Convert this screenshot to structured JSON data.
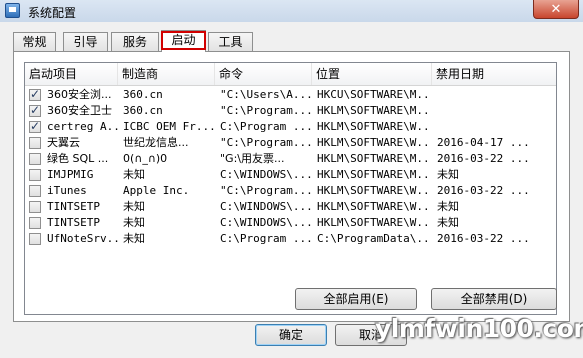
{
  "window": {
    "title": "系统配置",
    "close_glyph": "✕"
  },
  "tabs": [
    {
      "label": "常规",
      "active": false
    },
    {
      "label": "引导",
      "active": false
    },
    {
      "label": "服务",
      "active": false
    },
    {
      "label": "启动",
      "active": true
    },
    {
      "label": "工具",
      "active": false
    }
  ],
  "table": {
    "columns": [
      "启动项目",
      "制造商",
      "命令",
      "位置",
      "禁用日期"
    ],
    "rows": [
      {
        "checked": true,
        "item": "360安全浏...",
        "maker": "360.cn",
        "command": "\"C:\\Users\\A...",
        "location": "HKCU\\SOFTWARE\\M...",
        "date": ""
      },
      {
        "checked": true,
        "item": "360安全卫士",
        "maker": "360.cn",
        "command": "\"C:\\Program...",
        "location": "HKLM\\SOFTWARE\\M...",
        "date": ""
      },
      {
        "checked": true,
        "item": "certreg A...",
        "maker": "ICBC OEM Fr...",
        "command": "C:\\Program ...",
        "location": "HKLM\\SOFTWARE\\W...",
        "date": ""
      },
      {
        "checked": false,
        "item": "天翼云",
        "maker": "世纪龙信息...",
        "command": "\"C:\\Program...",
        "location": "HKLM\\SOFTWARE\\W...",
        "date": "2016-04-17 ..."
      },
      {
        "checked": false,
        "item": "绿色 SQL ...",
        "maker": "0(∩_∩)0",
        "command": "\"G:\\用友票...",
        "location": "HKLM\\SOFTWARE\\M...",
        "date": "2016-03-22 ..."
      },
      {
        "checked": false,
        "item": "IMJPMIG",
        "maker": "未知",
        "command": "C:\\WINDOWS\\...",
        "location": "HKLM\\SOFTWARE\\M...",
        "date": "未知"
      },
      {
        "checked": false,
        "item": "iTunes",
        "maker": "Apple Inc.",
        "command": "\"C:\\Program...",
        "location": "HKLM\\SOFTWARE\\W...",
        "date": "2016-03-22 ..."
      },
      {
        "checked": false,
        "item": "TINTSETP",
        "maker": "未知",
        "command": "C:\\WINDOWS\\...",
        "location": "HKLM\\SOFTWARE\\W...",
        "date": "未知"
      },
      {
        "checked": false,
        "item": "TINTSETP",
        "maker": "未知",
        "command": "C:\\WINDOWS\\...",
        "location": "HKLM\\SOFTWARE\\W...",
        "date": "未知"
      },
      {
        "checked": false,
        "item": "UfNoteSrv...",
        "maker": "未知",
        "command": "C:\\Program ...",
        "location": "C:\\ProgramData\\...",
        "date": "2016-03-22 ..."
      }
    ]
  },
  "buttons": {
    "enable_all": "全部启用(E)",
    "disable_all": "全部禁用(D)",
    "ok": "确定",
    "cancel": "取消"
  },
  "watermark": "ylmfwin100.com"
}
